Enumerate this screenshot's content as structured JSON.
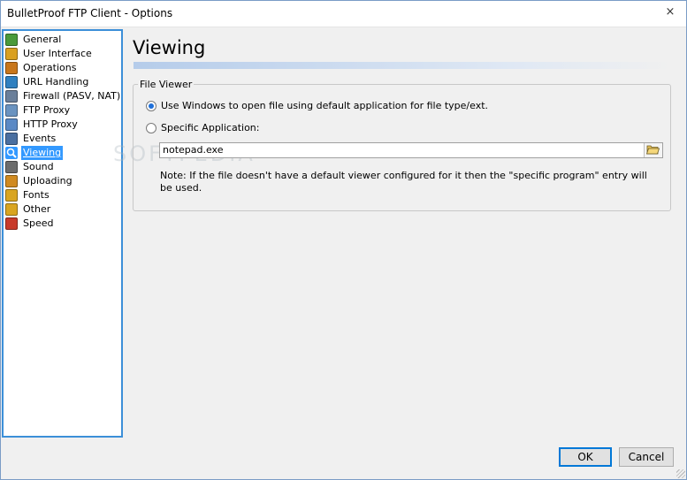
{
  "window": {
    "title": "BulletProof FTP Client - Options",
    "close_glyph": "×"
  },
  "sidebar": {
    "items": [
      {
        "label": "General",
        "icon": "settings-cog-icon",
        "color": "#4a9a3a"
      },
      {
        "label": "User Interface",
        "icon": "window-check-icon",
        "color": "#d9a020"
      },
      {
        "label": "Operations",
        "icon": "gear-folder-icon",
        "color": "#c8761a"
      },
      {
        "label": "URL Handling",
        "icon": "globe-link-icon",
        "color": "#2f80c0"
      },
      {
        "label": "Firewall (PASV, NAT)",
        "icon": "firewall-computer-icon",
        "color": "#6a7f9a"
      },
      {
        "label": "FTP Proxy",
        "icon": "proxy-computer-icon",
        "color": "#6a93c0"
      },
      {
        "label": "HTTP Proxy",
        "icon": "http-proxy-icon",
        "color": "#5a89c5"
      },
      {
        "label": "Events",
        "icon": "events-list-icon",
        "color": "#4a6fa0"
      },
      {
        "label": "Viewing",
        "icon": "magnifier-icon",
        "color": "#ffffff",
        "selected": true
      },
      {
        "label": "Sound",
        "icon": "speaker-icon",
        "color": "#6c6c6c"
      },
      {
        "label": "Uploading",
        "icon": "upload-icon",
        "color": "#d08a20"
      },
      {
        "label": "Fonts",
        "icon": "fonts-folder-icon",
        "color": "#d9a520"
      },
      {
        "label": "Other",
        "icon": "other-folder-icon",
        "color": "#d9a520"
      },
      {
        "label": "Speed",
        "icon": "speed-runner-icon",
        "color": "#c83a2a"
      }
    ]
  },
  "page": {
    "heading": "Viewing",
    "group_label": "File Viewer",
    "option_windows": "Use Windows to open file using default application for file type/ext.",
    "option_specific": "Specific Application:",
    "app_value": "notepad.exe",
    "note": "Note: If the file doesn't have a default viewer configured for it then the \"specific program\" entry will be used.",
    "selected_option": "windows"
  },
  "buttons": {
    "ok": "OK",
    "cancel": "Cancel"
  },
  "watermark": "SOFTPEDIA",
  "colors": {
    "accent": "#3399ff",
    "sidebar_border": "#3c8fd8",
    "radio_dot": "#1e6fd9"
  }
}
